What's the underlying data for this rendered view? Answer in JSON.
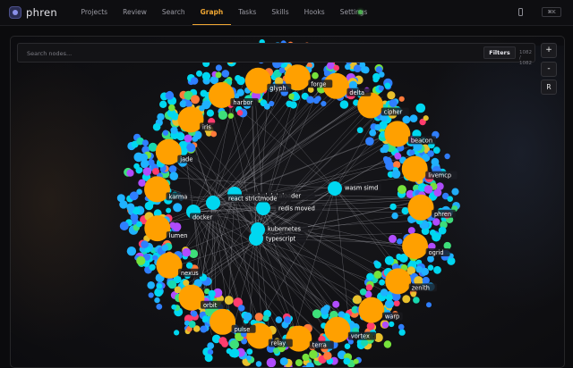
{
  "app": {
    "name": "phren"
  },
  "nav": {
    "items": [
      {
        "label": "Projects"
      },
      {
        "label": "Review"
      },
      {
        "label": "Search"
      },
      {
        "label": "Graph",
        "active": true
      },
      {
        "label": "Tasks"
      },
      {
        "label": "Skills"
      },
      {
        "label": "Hooks"
      },
      {
        "label": "Settings"
      }
    ],
    "status_color": "#4caf50",
    "shortcut": "⌘K"
  },
  "graph": {
    "search_placeholder": "Search nodes...",
    "filters_label": "Filters",
    "node_count": "1082 / 1082",
    "zoom_in_label": "+",
    "zoom_out_label": "-",
    "reset_label": "R",
    "colors": {
      "project": "#ffa000",
      "fact": "#00d7f0",
      "edge": "#d8d8e0",
      "label_bg": "#1a1a1e",
      "label_text": "#ffffff",
      "cluster_palette": [
        "#00d7f0",
        "#1fb2ff",
        "#2f7fff",
        "#3ee07a",
        "#76e23b",
        "#e8c02c",
        "#ff7a3a",
        "#ff3c6e",
        "#b04cff",
        "#18d8b0"
      ]
    },
    "projects": [
      {
        "label": "forge"
      },
      {
        "label": "delta"
      },
      {
        "label": "cipher"
      },
      {
        "label": "beacon"
      },
      {
        "label": "livemcp"
      },
      {
        "label": "phren"
      },
      {
        "label": "ogrid"
      },
      {
        "label": "zenith"
      },
      {
        "label": "warp"
      },
      {
        "label": "vortex"
      },
      {
        "label": "terra"
      },
      {
        "label": "relay"
      },
      {
        "label": "pulse"
      },
      {
        "label": "orbit"
      },
      {
        "label": "nexus"
      },
      {
        "label": "lumen"
      },
      {
        "label": "karma"
      },
      {
        "label": "jade"
      },
      {
        "label": "iris"
      },
      {
        "label": "harbor"
      },
      {
        "label": "glyph"
      }
    ],
    "center_nodes": [
      {
        "label": "wasm simd"
      },
      {
        "label": "graphql dataloader"
      },
      {
        "label": "react strictmode"
      },
      {
        "label": "docker"
      },
      {
        "label": "redis moved"
      },
      {
        "label": "kubernetes"
      },
      {
        "label": "typescript"
      }
    ]
  }
}
